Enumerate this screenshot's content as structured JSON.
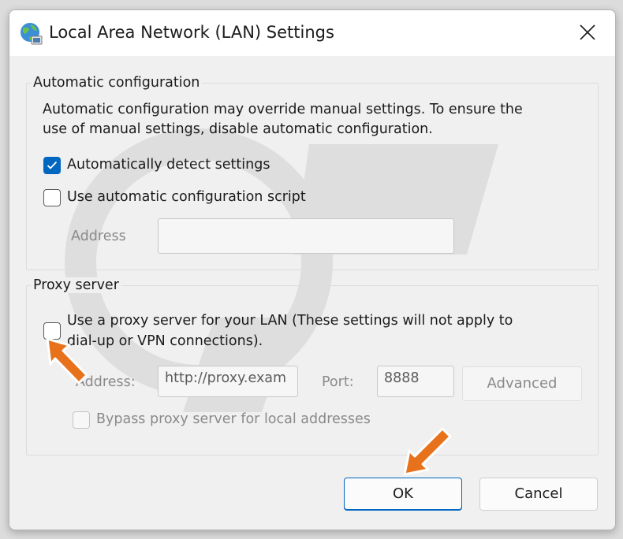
{
  "window": {
    "title": "Local Area Network (LAN) Settings",
    "title_icon": "globe-network-icon",
    "close_icon": "close-icon"
  },
  "auto_config": {
    "legend": "Automatic configuration",
    "description_line1": "Automatic configuration may override manual settings.  To ensure the",
    "description_line2": "use of manual settings, disable automatic configuration.",
    "detect_label": "Automatically detect settings",
    "detect_checked": true,
    "script_label": "Use automatic configuration script",
    "script_checked": false,
    "address_label": "Address",
    "address_value": ""
  },
  "proxy": {
    "legend": "Proxy server",
    "use_proxy_line1": "Use a proxy server for your LAN (These settings will not apply to",
    "use_proxy_line2": "dial-up or VPN connections).",
    "use_proxy_checked": false,
    "address_label": "Address:",
    "address_value": "http://proxy.exam",
    "port_label": "Port:",
    "port_value": "8888",
    "advanced_label": "Advanced",
    "bypass_label": "Bypass proxy server for local addresses",
    "bypass_checked": false
  },
  "footer": {
    "ok_label": "OK",
    "cancel_label": "Cancel"
  },
  "colors": {
    "accent": "#0067c0",
    "annotation_arrow": "#e8721c"
  }
}
